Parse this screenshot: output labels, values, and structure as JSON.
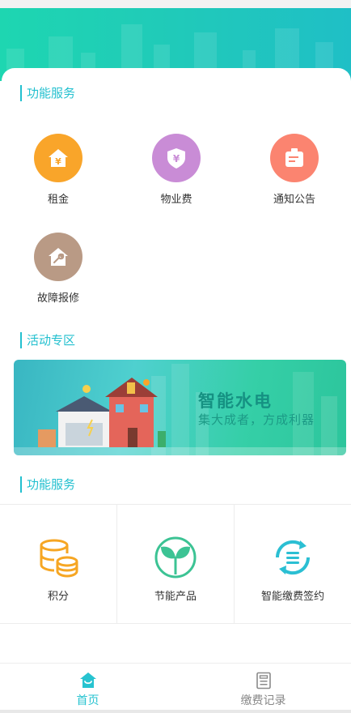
{
  "section1": {
    "title": "功能服务",
    "items": [
      {
        "label": "租金",
        "icon": "yen-house-icon",
        "color": "#f9a52a"
      },
      {
        "label": "物业费",
        "icon": "yen-shield-icon",
        "color": "#c98cd6"
      },
      {
        "label": "通知公告",
        "icon": "notice-board-icon",
        "color": "#fb8470"
      },
      {
        "label": "故障报修",
        "icon": "repair-house-icon",
        "color": "#b99a85"
      }
    ]
  },
  "activity": {
    "title": "活动专区",
    "banner": {
      "title": "智能水电",
      "subtitle": "集大成者，方成利器"
    }
  },
  "section2": {
    "title": "功能服务",
    "items": [
      {
        "label": "积分",
        "icon": "coins-icon",
        "color": "#f6a623"
      },
      {
        "label": "节能产品",
        "icon": "sprout-icon",
        "color": "#3cc394"
      },
      {
        "label": "智能缴费签约",
        "icon": "sync-list-icon",
        "color": "#2bbfd3"
      }
    ]
  },
  "tabbar": {
    "items": [
      {
        "label": "首页",
        "icon": "home-icon",
        "active": true
      },
      {
        "label": "缴费记录",
        "icon": "document-icon",
        "active": false
      }
    ]
  },
  "colors": {
    "accent": "#23c0cf",
    "header": "#1ed6b1"
  }
}
